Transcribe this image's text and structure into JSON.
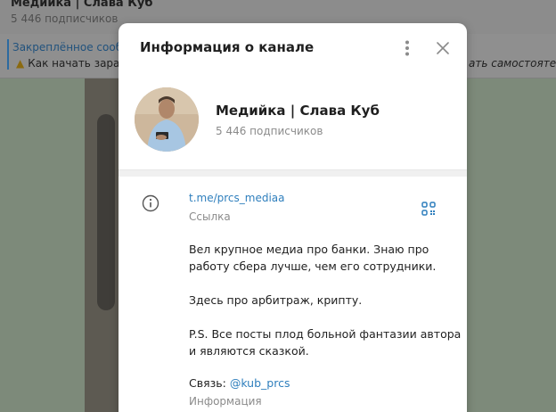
{
  "background": {
    "chat_title": "Медийка | Слава Куб",
    "chat_subscribers": "5 446 подписчиков",
    "pinned_title": "Закреплённое сооб",
    "pinned_text": "Как начать зара",
    "pinned_right_text": "ать самостоятел"
  },
  "modal": {
    "title": "Информация о канале",
    "more_icon": "more-vertical-icon",
    "close_icon": "close-icon"
  },
  "channel": {
    "name": "Медийка | Слава Куб",
    "subscribers": "5 446 подписчиков"
  },
  "info": {
    "link": "t.me/prcs_mediaa",
    "link_label": "Ссылка",
    "description": [
      "Вел крупное медиа про банки. Знаю про",
      "работу сбера лучше, чем его сотрудники.",
      "Здесь про арбитраж, крипту.",
      "P.S. Все посты плод больной фантазии автора",
      "и являются сказкой."
    ],
    "contact_prefix": "Связь: ",
    "contact_handle": "@kub_prcs",
    "contact_label": "Информация"
  },
  "colors": {
    "accent": "#2f7fbd",
    "muted": "#8b8b8b"
  }
}
